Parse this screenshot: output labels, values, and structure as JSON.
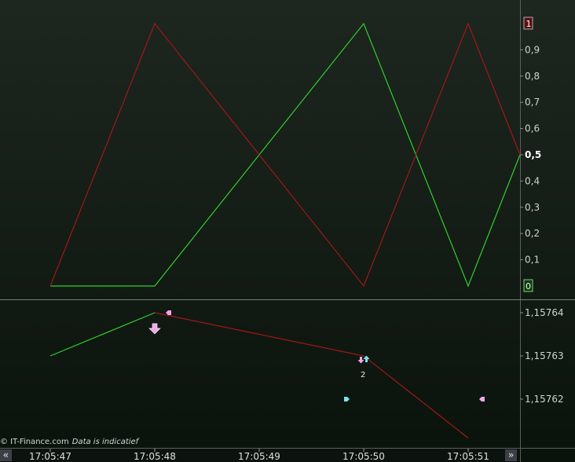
{
  "credit": {
    "source": "© IT-Finance.com",
    "note": "Data is indicatief"
  },
  "nav": {
    "left": "«",
    "right": "»"
  },
  "colors": {
    "background_top": "#1e2620",
    "background_bottom": "#0a130b",
    "axis_text": "#cfd3cf",
    "green_line": "#2fd02f",
    "red_line": "#a01818",
    "divider": "#7a7f7a",
    "marker_pink": "#f0a8e8",
    "marker_cyan": "#7ee0f0"
  },
  "chart_data": [
    {
      "type": "line",
      "title": "",
      "x": [
        "17:05:47",
        "17:05:48",
        "17:05:50",
        "17:05:51",
        "17:05:51.5"
      ],
      "series": [
        {
          "values": [
            0,
            0,
            1,
            0,
            0.5
          ],
          "color": "green"
        },
        {
          "values": [
            0,
            1,
            0,
            1,
            0.5
          ],
          "color": "red"
        }
      ],
      "ylim": [
        0,
        1
      ],
      "yticks": [
        "0,1",
        "0,2",
        "0,3",
        "0,4",
        "0,5",
        "0,6",
        "0,7",
        "0,8",
        "0,9"
      ],
      "ytick_values": [
        0.1,
        0.2,
        0.3,
        0.4,
        0.5,
        0.6,
        0.7,
        0.8,
        0.9
      ],
      "highlight_tick": "0,5",
      "end_labels": {
        "red": "1",
        "green": "0"
      }
    },
    {
      "type": "line",
      "title": "",
      "segments": [
        {
          "color": "green",
          "points": [
            [
              "17:05:47",
              1.15763
            ],
            [
              "17:05:48",
              1.15764
            ]
          ]
        },
        {
          "color": "red",
          "points": [
            [
              "17:05:48",
              1.15764
            ],
            [
              "17:05:50",
              1.15763
            ],
            [
              "17:05:51",
              1.157611
            ]
          ]
        }
      ],
      "yticks": [
        "1,15762",
        "1,15763",
        "1,15764"
      ],
      "ytick_values": [
        1.15762,
        1.15763,
        1.15764
      ],
      "ylim": [
        1.157611,
        1.157647
      ],
      "annotations": [
        {
          "kind": "down-arrow",
          "x": "17:05:48",
          "y": 1.1576382,
          "color": "pink"
        },
        {
          "kind": "flag-left",
          "x": "17:05:48",
          "y": 1.15764,
          "color": "pink"
        },
        {
          "kind": "down-arrow-small",
          "x": "17:05:50",
          "y": 1.1576298,
          "color": "pink"
        },
        {
          "kind": "up-arrow-small",
          "x": "17:05:50",
          "y": 1.15763,
          "color": "cyan"
        },
        {
          "kind": "count-label",
          "x": "17:05:50",
          "y": 1.1576275,
          "text": "2"
        },
        {
          "kind": "flag-right",
          "x": "17:05:50",
          "y": 1.15762,
          "color": "cyan"
        },
        {
          "kind": "flag-left",
          "x": "17:05:51",
          "y": 1.15762,
          "color": "pink"
        }
      ]
    }
  ],
  "x_axis": {
    "ticks": [
      "17:05:47",
      "17:05:48",
      "17:05:49",
      "17:05:50",
      "17:05:51"
    ]
  }
}
